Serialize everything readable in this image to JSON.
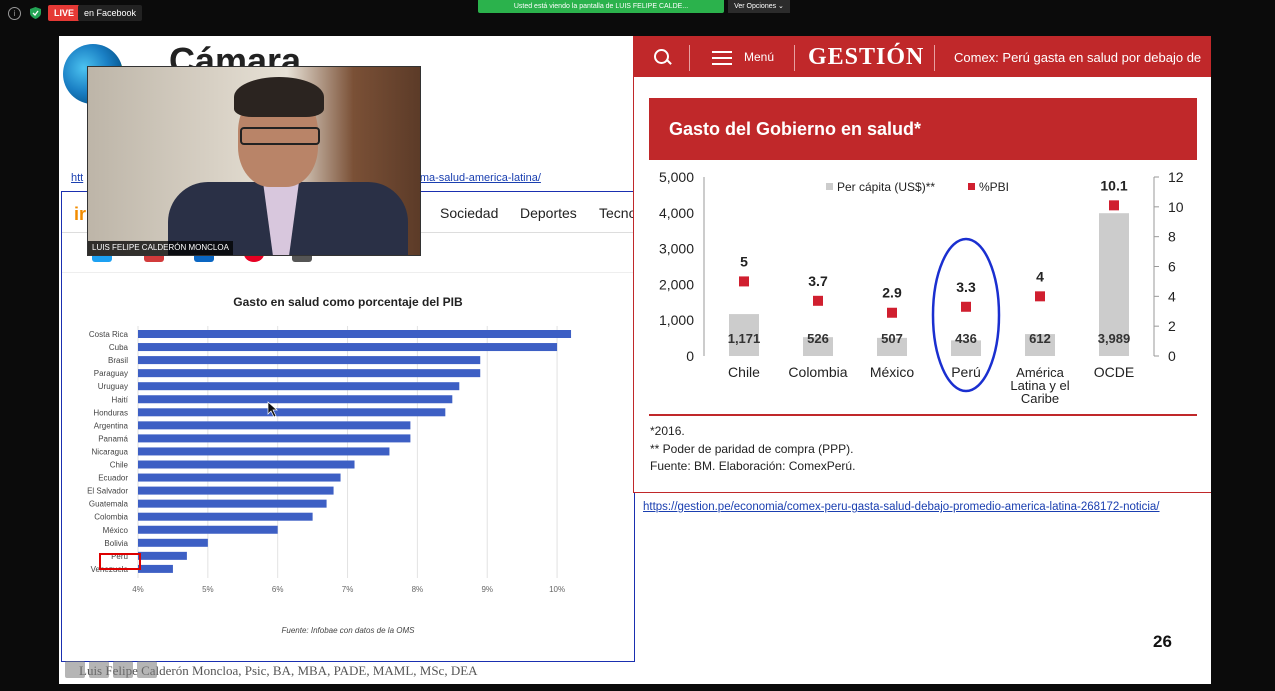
{
  "meeting": {
    "live_label": "LIVE",
    "destination": "en Facebook",
    "share_banner": "Usted está viendo la pantalla de LUIS FELIPE CALDE...",
    "view_options": "Ver Opciones"
  },
  "slide": {
    "logo_text": "Cámara",
    "url_top_left": "htt",
    "url_top_right": "ejor-sistema-salud-america-latina/",
    "webcam_name": "LUIS FELIPE CALDERÓN MONCLOA",
    "infobae": {
      "logo": "ir",
      "menu": [
        "Sociedad",
        "Deportes",
        "Tecno"
      ],
      "chart_title": "Gasto en salud como porcentaje del PIB",
      "source": "Fuente: Infobae con datos de la OMS"
    },
    "gestion": {
      "menu_label": "Menú",
      "brand": "GESTIÓN",
      "headline": "Comex: Perú gasta en salud por debajo de",
      "chart_title": "Gasto del Gobierno en salud*",
      "note1": "*2016.",
      "note2": "** Poder de paridad de compra (PPP).",
      "note3": "Fuente: BM. Elaboración: ComexPerú."
    },
    "url_bottom": "https://gestion.pe/economia/comex-peru-gasta-salud-debajo-promedio-america-latina-268172-noticia/",
    "slide_number": "26",
    "credit": "Luis Felipe Calderón Moncloa, Psic, BA, MBA, PADE, MAML, MSc, DEA"
  },
  "chart_data": [
    {
      "type": "bar",
      "orientation": "horizontal",
      "title": "Gasto en salud como porcentaje del PIB",
      "categories": [
        "Costa Rica",
        "Cuba",
        "Brasil",
        "Paraguay",
        "Uruguay",
        "Haití",
        "Honduras",
        "Argentina",
        "Panamá",
        "Nicaragua",
        "Chile",
        "Ecuador",
        "El Salvador",
        "Guatemala",
        "Colombia",
        "México",
        "Bolivia",
        "Perú",
        "Venezuela"
      ],
      "values": [
        10.2,
        10.0,
        8.9,
        8.9,
        8.6,
        8.5,
        8.4,
        7.9,
        7.9,
        7.6,
        7.1,
        6.9,
        6.8,
        6.7,
        6.5,
        6.0,
        5.0,
        4.7,
        4.5
      ],
      "xticks": [
        "4%",
        "5%",
        "6%",
        "7%",
        "8%",
        "9%",
        "10%"
      ],
      "xlim": [
        4,
        10.5
      ],
      "color": "#3d5fc4",
      "highlight": "Perú",
      "grid": true
    },
    {
      "type": "bar",
      "title": "Gasto del Gobierno en salud*",
      "categories": [
        "Chile",
        "Colombia",
        "México",
        "Perú",
        "América Latina y el Caribe",
        "OCDE"
      ],
      "series": [
        {
          "name": "Per cápita (US$)**",
          "values": [
            1171,
            526,
            507,
            436,
            612,
            3989
          ],
          "labels": [
            "1,171",
            "526",
            "507",
            "436",
            "612",
            "3,989"
          ],
          "color": "#cccccc",
          "axis": "left"
        },
        {
          "name": "%PBI",
          "values": [
            5,
            3.7,
            2.9,
            3.3,
            4,
            10.1
          ],
          "labels": [
            "5",
            "3.7",
            "2.9",
            "3.3",
            "4",
            "10.1"
          ],
          "color": "#d01f2f",
          "axis": "right",
          "marker": "square"
        }
      ],
      "ylim_left": [
        0,
        5000
      ],
      "yticks_left": [
        "0",
        "1,000",
        "2,000",
        "3,000",
        "4,000",
        "5,000"
      ],
      "ylim_right": [
        0,
        12
      ],
      "yticks_right": [
        "0",
        "2",
        "4",
        "6",
        "8",
        "10",
        "12"
      ],
      "highlight": "Perú",
      "legend": "top"
    }
  ]
}
